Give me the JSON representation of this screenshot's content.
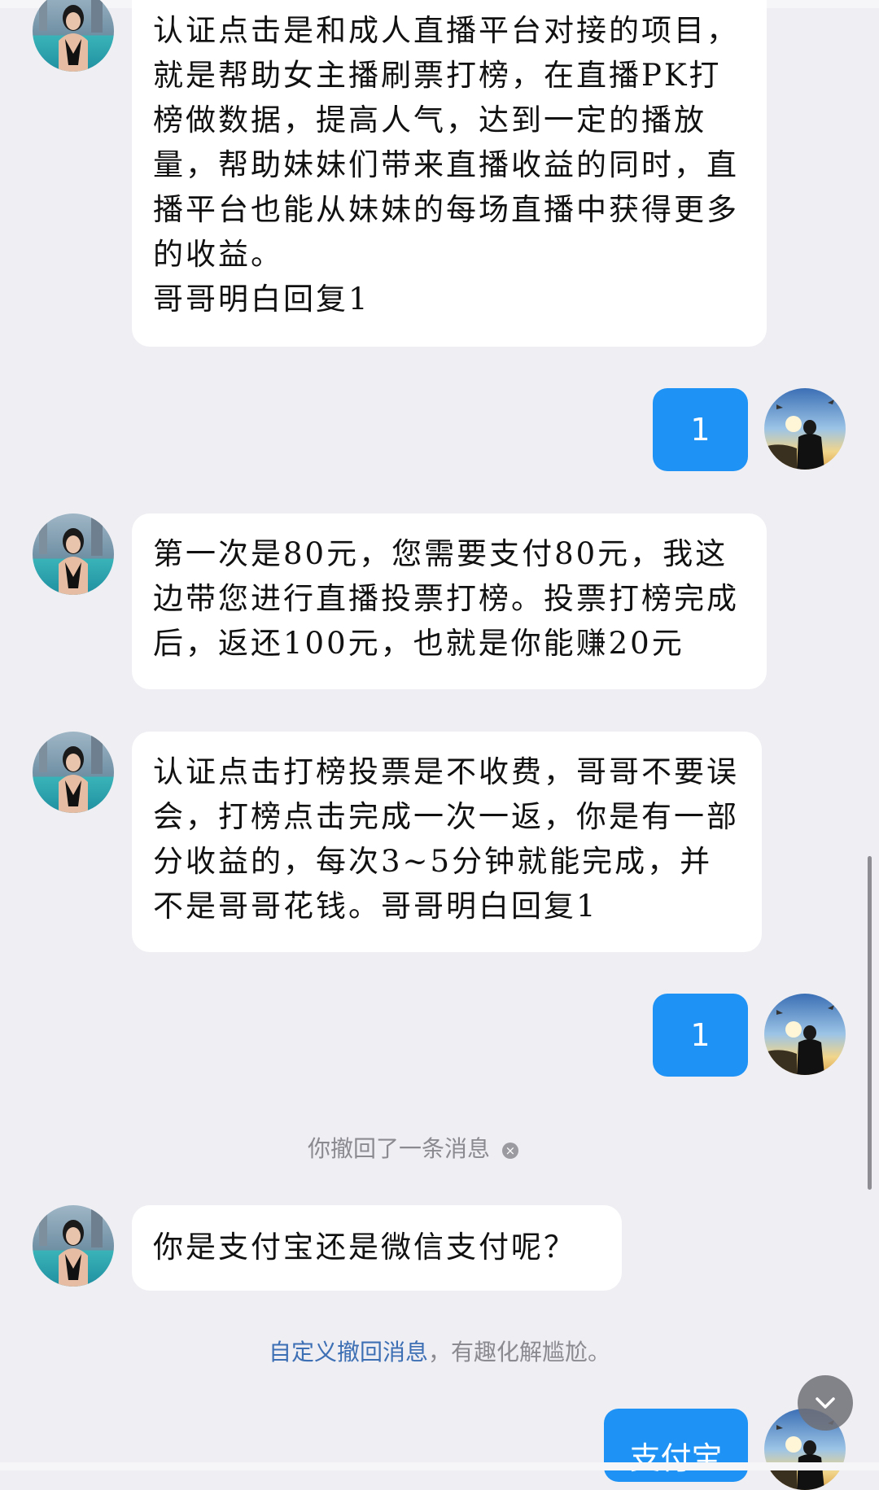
{
  "messages": [
    {
      "side": "left",
      "text": "认证点击是和成人直播平台对接的项目，就是帮助女主播刷票打榜，在直播PK打榜做数据，提高人气，达到一定的播放量，帮助妹妹们带来直播收益的同时，直播平台也能从妹妹的每场直播中获得更多的收益。\n哥哥明白回复1"
    },
    {
      "side": "right",
      "text": "1"
    },
    {
      "side": "left",
      "text": "第一次是80元，您需要支付80元，我这边带您进行直播投票打榜。投票打榜完成后，返还100元，也就是你能赚20元"
    },
    {
      "side": "left",
      "text": "认证点击打榜投票是不收费，哥哥不要误会，打榜点击完成一次一返，你是有一部分收益的，每次3~5分钟就能完成，并不是哥哥花钱。哥哥明白回复1"
    },
    {
      "side": "right",
      "text": "1"
    },
    {
      "side": "left",
      "text": "你是支付宝还是微信支付呢？"
    },
    {
      "side": "right",
      "text": "支付宝"
    }
  ],
  "system": {
    "recalled": "你撤回了一条消息",
    "tip_link": "自定义撤回消息",
    "tip_rest": "，有趣化解尴尬。"
  },
  "colors": {
    "my_bubble": "#1e93f5",
    "background": "#eeeef3",
    "link": "#3d6fb4"
  },
  "icons": {
    "recall_close": "close-circle-icon",
    "scroll_down": "chevron-down-icon"
  }
}
